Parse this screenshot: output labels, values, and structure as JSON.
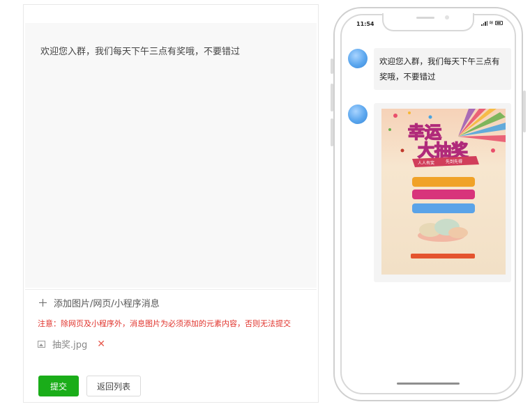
{
  "editor": {
    "welcome_text": "欢迎您入群，我们每天下午三点有奖哦，不要错过",
    "add_label": "添加图片/网页/小程序消息",
    "notice": "注意：除网页及小程序外，消息图片为必须添加的元素内容，否则无法提交",
    "file_name": "抽奖.jpg",
    "remove_symbol": "✕",
    "submit_label": "提交",
    "back_label": "返回列表"
  },
  "phone": {
    "time": "11:54",
    "message_text": "欢迎您入群，我们每天下午三点有奖哦，不要错过",
    "poster": {
      "title_line1": "幸运",
      "title_line2": "大抽奖",
      "ribbon_left": "人人有奖",
      "ribbon_right": "先到先得"
    }
  },
  "colors": {
    "primary_green": "#1aad19",
    "notice_red": "#e0322b",
    "bar_orange": "#f0a228",
    "bar_pink": "#e04f86",
    "bar_blue": "#5aa3e8",
    "bottom_bar_red": "#e4532e"
  }
}
